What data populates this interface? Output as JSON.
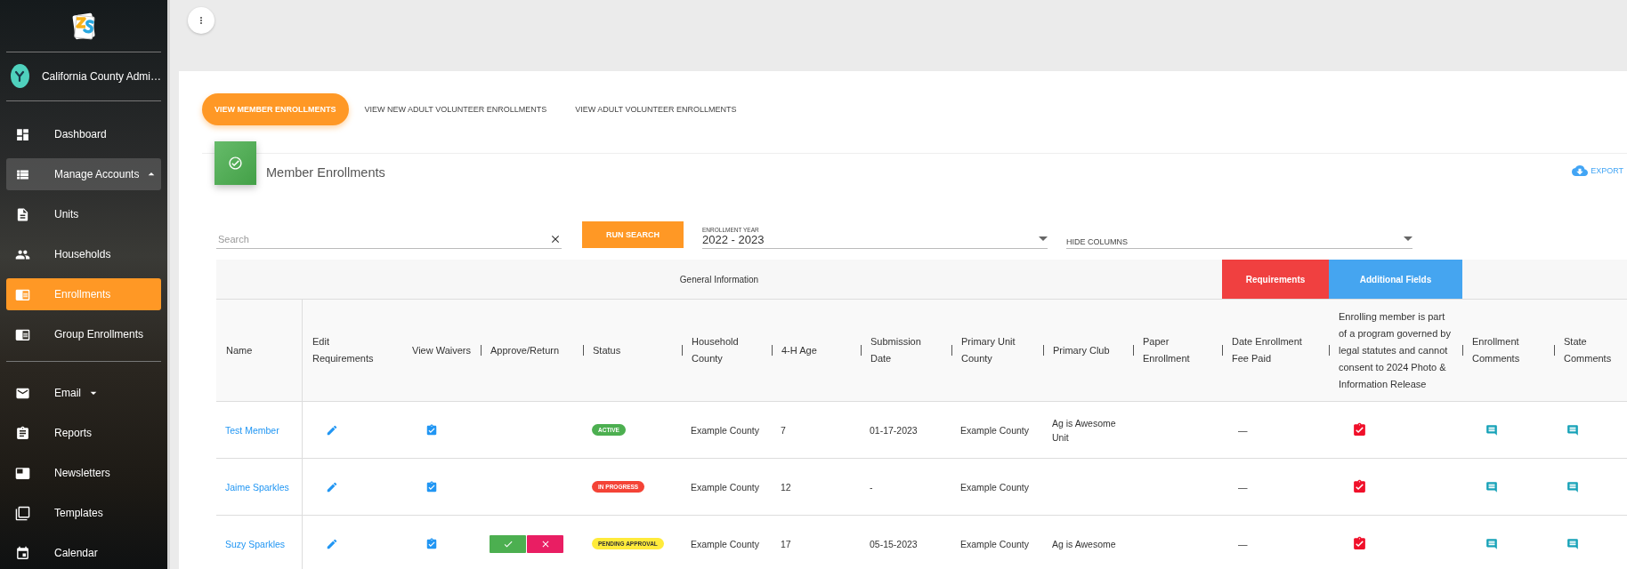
{
  "sidebar": {
    "user": {
      "name": "California County Admi…"
    },
    "sections": [
      [
        {
          "label": "Dashboard",
          "selected": false
        },
        {
          "label": "Manage Accounts",
          "selected": false,
          "expanded": true,
          "children": [
            {
              "label": "Units",
              "selected": false
            },
            {
              "label": "Households",
              "selected": false
            },
            {
              "label": "Enrollments",
              "selected": true
            },
            {
              "label": "Group Enrollments",
              "selected": false
            }
          ]
        }
      ],
      [
        {
          "label": "Email",
          "selected": false,
          "expanded": false
        },
        {
          "label": "Reports",
          "selected": false
        },
        {
          "label": "Newsletters",
          "selected": false
        },
        {
          "label": "Templates",
          "selected": false
        },
        {
          "label": "Calendar",
          "selected": false
        }
      ]
    ]
  },
  "tabs": [
    {
      "label": "VIEW MEMBER ENROLLMENTS",
      "selected": true
    },
    {
      "label": "VIEW NEW ADULT VOLUNTEER ENROLLMENTS",
      "selected": false
    },
    {
      "label": "VIEW ADULT VOLUNTEER ENROLLMENTS",
      "selected": false
    }
  ],
  "panel": {
    "title": "Member Enrollments",
    "export": "EXPORT"
  },
  "filters": {
    "search": {
      "placeholder": "Search"
    },
    "run_search": "RUN SEARCH",
    "enrollment_year": {
      "label": "ENROLLMENT YEAR",
      "value": "2022 - 2023"
    },
    "hide_columns": {
      "placeholder": "HIDE COLUMNS"
    }
  },
  "table": {
    "groups": [
      {
        "label": "General Information",
        "kind": "plain"
      },
      {
        "label": "Requirements",
        "kind": "requirements"
      },
      {
        "label": "Additional Fields",
        "kind": "additional"
      }
    ],
    "columns": [
      "Name",
      "Edit Requirements",
      "View Waivers",
      "Approve/Return",
      "Status",
      "Household County",
      "4-H Age",
      "Submission Date",
      "Primary Unit County",
      "Primary Club",
      "Paper Enrollment",
      "Date Enrollment Fee Paid",
      "Enrolling member is part of a program governed by legal statutes and cannot consent to 2024 Photo & Information Release",
      "Enrollment Comments",
      "State Comments"
    ],
    "rows": [
      {
        "name": "Test Member",
        "approval_pending": false,
        "status": {
          "label": "ACTIVE",
          "color": "#4caf50"
        },
        "household_county": "Example County",
        "age": "7",
        "submission_date": "01-17-2023",
        "primary_unit_county": "Example County",
        "primary_club": "Ag is Awesome Unit",
        "fee_paid": "—"
      },
      {
        "name": "Jaime Sparkles",
        "approval_pending": false,
        "status": {
          "label": "IN PROGRESS",
          "color": "#f44336"
        },
        "household_county": "Example County",
        "age": "12",
        "submission_date": "-",
        "primary_unit_county": "Example County",
        "fee_paid": "—"
      },
      {
        "name": "Suzy Sparkles",
        "approval_pending": true,
        "status": {
          "label": "PENDING APPROVAL",
          "color": "#ffeb3b"
        },
        "household_county": "Example County",
        "age": "17",
        "submission_date": "05-15-2023",
        "primary_unit_county": "Example County",
        "primary_club": "Ag is Awesome",
        "fee_paid": "—"
      }
    ]
  }
}
